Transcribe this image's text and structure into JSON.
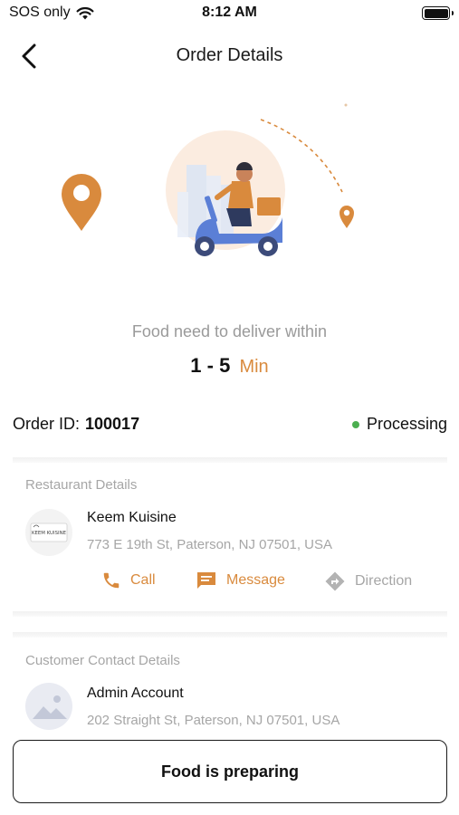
{
  "status_bar": {
    "carrier": "SOS only",
    "time": "8:12 AM"
  },
  "nav": {
    "title": "Order Details"
  },
  "delivery": {
    "label": "Food need to deliver within",
    "range": "1 - 5",
    "unit": "Min"
  },
  "order": {
    "id_label": "Order ID:",
    "id_value": "100017",
    "status": "Processing",
    "status_color": "#4caf50"
  },
  "restaurant": {
    "section_title": "Restaurant Details",
    "name": "Keem Kuisine",
    "address": "773 E 19th St, Paterson, NJ 07501, USA",
    "logo_text": "KEEM KUISINE",
    "actions": {
      "call": "Call",
      "message": "Message",
      "direction": "Direction"
    }
  },
  "customer": {
    "section_title": "Customer Contact Details",
    "name": "Admin Account",
    "address": "202 Straight St, Paterson, NJ 07501, USA"
  },
  "footer": {
    "button_label": "Food is preparing"
  },
  "colors": {
    "accent": "#d98a3d",
    "muted": "#a6a6a6",
    "scooter": "#5b7fd6"
  }
}
